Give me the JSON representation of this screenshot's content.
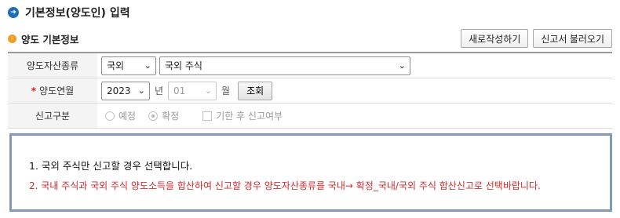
{
  "page": {
    "title": "기본정보(양도인) 입력",
    "title_icon": "arrow-right-circle-icon"
  },
  "section": {
    "title": "양도 기본정보",
    "buttons": {
      "new": "새로작성하기",
      "load": "신고서 불러오기"
    }
  },
  "form": {
    "asset_type": {
      "label": "양도자산종류",
      "primary_value": "국외",
      "secondary_value": "국외 주식"
    },
    "period": {
      "label": "양도연월",
      "required_mark": "*",
      "year": "2023",
      "year_unit": "년",
      "month": "01",
      "month_unit": "월",
      "search_button": "조회"
    },
    "report_type": {
      "label": "신고구분",
      "options": [
        "예정",
        "확정"
      ],
      "selected": "확정",
      "late_filing_checkbox": "기한 후 신고여부"
    }
  },
  "notice": {
    "line1": "1. 국외 주식만 신고할 경우 선택합니다.",
    "line2": "2. 국내 주식과 국외 주식 양도소득을 합산하여 신고할 경우 양도자산종류를 국내→ 확정_국내/국외 주식 합산신고로 선택바랍니다."
  },
  "colors": {
    "title_icon": "#1f6fb8",
    "section_dot": "#f0a020",
    "required": "#d02020",
    "notice_border": "#8298b5",
    "notice_warning": "#d22b2b"
  }
}
